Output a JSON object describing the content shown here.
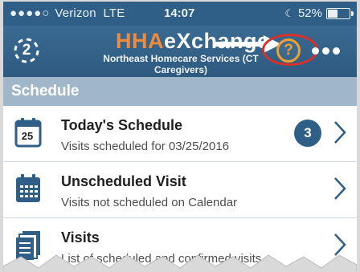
{
  "status_bar": {
    "carrier_dots": "●●●●○",
    "carrier": "Verizon",
    "network": "LTE",
    "time": "14:07",
    "battery_percent": "52%",
    "battery_level": 0.52
  },
  "header": {
    "account_count": "2",
    "logo_part1": "HHA",
    "logo_part2": "eXchange",
    "agency_name": "Northeast Homecare Services (CT Caregivers)",
    "help_symbol": "?"
  },
  "section": {
    "title": "Schedule"
  },
  "items": [
    {
      "title": "Today's Schedule",
      "subtitle": "Visits scheduled for 03/25/2016",
      "icon": "calendar-today-icon",
      "icon_day": "25",
      "badge": "3"
    },
    {
      "title": "Unscheduled Visit",
      "subtitle": "Visits not scheduled on Calendar",
      "icon": "calendar-grid-icon"
    },
    {
      "title": "Visits",
      "subtitle": "List of scheduled and confirmed visits",
      "icon": "visits-list-icon"
    }
  ],
  "colors": {
    "header_bg": "#2f5f86",
    "logo_orange": "#f08a3c",
    "help_orange": "#f0a030",
    "annotation_red": "#d9302a",
    "section_bar": "#9fb7c9"
  }
}
